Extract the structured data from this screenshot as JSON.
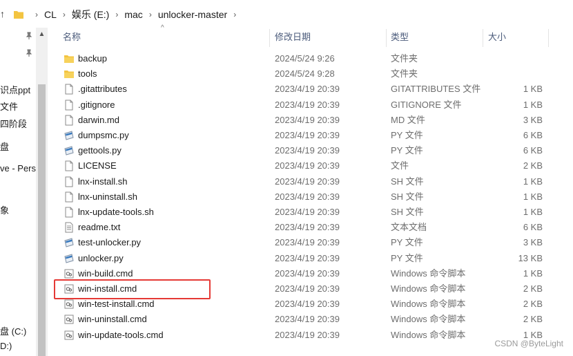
{
  "breadcrumb": [
    "CL",
    "娱乐 (E:)",
    "mac",
    "unlocker-master"
  ],
  "nav": {
    "items": [
      "识点ppt",
      "文件",
      "四阶段",
      "盘",
      "ve - Perso",
      "象",
      "盘 (C:)",
      "D:)"
    ]
  },
  "columns": {
    "name": "名称",
    "date": "修改日期",
    "type": "类型",
    "size": "大小"
  },
  "files": [
    {
      "name": "backup",
      "date": "2024/5/24 9:26",
      "type": "文件夹",
      "size": "",
      "icon": "folder-icon"
    },
    {
      "name": "tools",
      "date": "2024/5/24 9:28",
      "type": "文件夹",
      "size": "",
      "icon": "folder-icon"
    },
    {
      "name": ".gitattributes",
      "date": "2023/4/19 20:39",
      "type": "GITATTRIBUTES 文件",
      "size": "1 KB",
      "icon": "file-icon"
    },
    {
      "name": ".gitignore",
      "date": "2023/4/19 20:39",
      "type": "GITIGNORE 文件",
      "size": "1 KB",
      "icon": "file-icon"
    },
    {
      "name": "darwin.md",
      "date": "2023/4/19 20:39",
      "type": "MD 文件",
      "size": "3 KB",
      "icon": "file-icon"
    },
    {
      "name": "dumpsmc.py",
      "date": "2023/4/19 20:39",
      "type": "PY 文件",
      "size": "6 KB",
      "icon": "python-file-icon"
    },
    {
      "name": "gettools.py",
      "date": "2023/4/19 20:39",
      "type": "PY 文件",
      "size": "6 KB",
      "icon": "python-file-icon"
    },
    {
      "name": "LICENSE",
      "date": "2023/4/19 20:39",
      "type": "文件",
      "size": "2 KB",
      "icon": "file-icon"
    },
    {
      "name": "lnx-install.sh",
      "date": "2023/4/19 20:39",
      "type": "SH 文件",
      "size": "1 KB",
      "icon": "file-icon"
    },
    {
      "name": "lnx-uninstall.sh",
      "date": "2023/4/19 20:39",
      "type": "SH 文件",
      "size": "1 KB",
      "icon": "file-icon"
    },
    {
      "name": "lnx-update-tools.sh",
      "date": "2023/4/19 20:39",
      "type": "SH 文件",
      "size": "1 KB",
      "icon": "file-icon"
    },
    {
      "name": "readme.txt",
      "date": "2023/4/19 20:39",
      "type": "文本文档",
      "size": "6 KB",
      "icon": "text-file-icon"
    },
    {
      "name": "test-unlocker.py",
      "date": "2023/4/19 20:39",
      "type": "PY 文件",
      "size": "3 KB",
      "icon": "python-file-icon"
    },
    {
      "name": "unlocker.py",
      "date": "2023/4/19 20:39",
      "type": "PY 文件",
      "size": "13 KB",
      "icon": "python-file-icon"
    },
    {
      "name": "win-build.cmd",
      "date": "2023/4/19 20:39",
      "type": "Windows 命令脚本",
      "size": "1 KB",
      "icon": "cmd-file-icon"
    },
    {
      "name": "win-install.cmd",
      "date": "2023/4/19 20:39",
      "type": "Windows 命令脚本",
      "size": "2 KB",
      "icon": "cmd-file-icon",
      "highlighted": true
    },
    {
      "name": "win-test-install.cmd",
      "date": "2023/4/19 20:39",
      "type": "Windows 命令脚本",
      "size": "2 KB",
      "icon": "cmd-file-icon"
    },
    {
      "name": "win-uninstall.cmd",
      "date": "2023/4/19 20:39",
      "type": "Windows 命令脚本",
      "size": "2 KB",
      "icon": "cmd-file-icon"
    },
    {
      "name": "win-update-tools.cmd",
      "date": "2023/4/19 20:39",
      "type": "Windows 命令脚本",
      "size": "1 KB",
      "icon": "cmd-file-icon"
    }
  ],
  "watermark": "CSDN @ByteLight",
  "colors": {
    "highlight": "#e53935",
    "folder": "#f3c441",
    "header_text": "#4a5a7a"
  }
}
